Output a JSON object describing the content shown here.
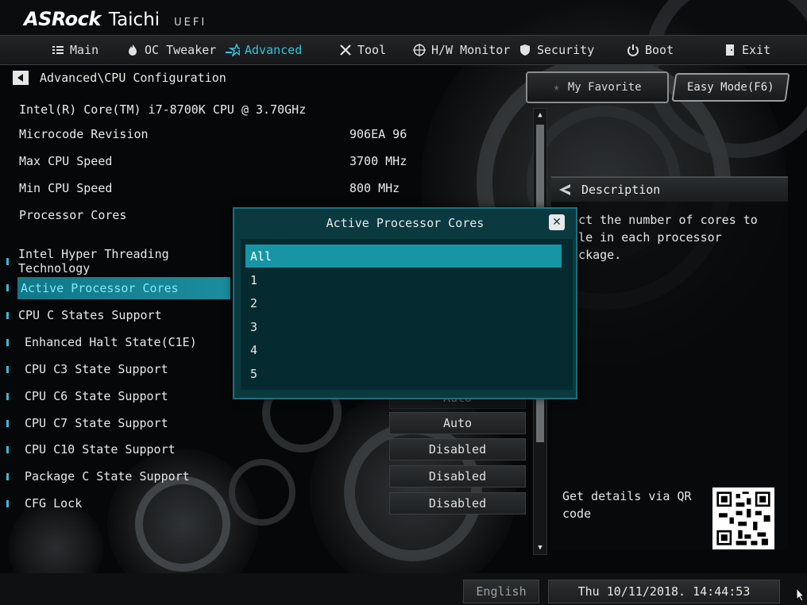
{
  "header": {
    "brand": "ASRock",
    "model": "Taichi",
    "firmware": "UEFI"
  },
  "nav": [
    {
      "label": "Main",
      "icon": "list-icon"
    },
    {
      "label": "OC Tweaker",
      "icon": "flame-icon"
    },
    {
      "label": "Advanced",
      "icon": "star-icon",
      "active": true
    },
    {
      "label": "Tool",
      "icon": "tools-icon"
    },
    {
      "label": "H/W Monitor",
      "icon": "target-icon"
    },
    {
      "label": "Security",
      "icon": "shield-icon"
    },
    {
      "label": "Boot",
      "icon": "power-icon"
    },
    {
      "label": "Exit",
      "icon": "door-icon"
    }
  ],
  "breadcrumb": "Advanced\\CPU Configuration",
  "cpu_name": "Intel(R) Core(TM) i7-8700K CPU @ 3.70GHz",
  "info": [
    {
      "label": "Microcode Revision",
      "value": "906EA 96"
    },
    {
      "label": "Max CPU Speed",
      "value": "3700 MHz"
    },
    {
      "label": "Min CPU Speed",
      "value": "800 MHz"
    },
    {
      "label": "Processor Cores",
      "value": ""
    }
  ],
  "settings": [
    {
      "label": "Intel Hyper Threading Technology",
      "value": ""
    },
    {
      "label": "Active Processor Cores",
      "value": "",
      "selected": true
    },
    {
      "label": "CPU C States Support",
      "value": ""
    },
    {
      "label": "Enhanced Halt State(C1E)",
      "value": ""
    },
    {
      "label": "CPU C3 State Support",
      "value": ""
    },
    {
      "label": "CPU C6 State Support",
      "value": "Auto"
    },
    {
      "label": "CPU C7 State Support",
      "value": "Auto"
    },
    {
      "label": "CPU C10 State Support",
      "value": "Disabled"
    },
    {
      "label": "Package C State Support",
      "value": "Disabled"
    },
    {
      "label": "CFG Lock",
      "value": "Disabled"
    }
  ],
  "favorite_label": "My Favorite",
  "easy_mode_label": "Easy Mode(F6)",
  "description": {
    "title": "Description",
    "text": "lect the number of cores to able in each processor package.",
    "qr_label": "Get details via QR code"
  },
  "footer": {
    "language": "English",
    "datetime": "Thu 10/11/2018. 14:44:53"
  },
  "modal": {
    "title": "Active Processor Cores",
    "options": [
      "All",
      "1",
      "2",
      "3",
      "4",
      "5"
    ],
    "selected": "All"
  },
  "colors": {
    "accent": "#33c4dd",
    "selection": "#1895a5",
    "modal_bg": "#0a3a40"
  }
}
